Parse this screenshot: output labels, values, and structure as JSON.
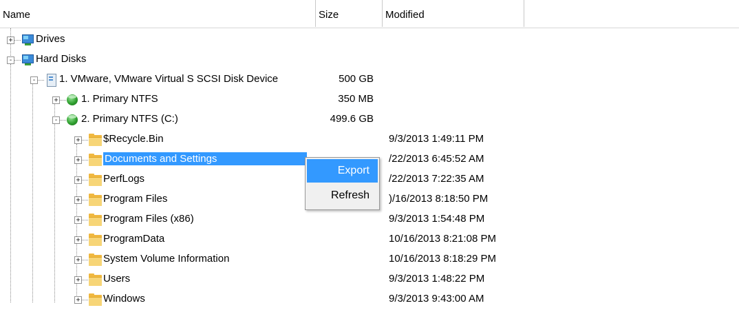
{
  "columns": {
    "name": "Name",
    "size": "Size",
    "modified": "Modified"
  },
  "tree": [
    {
      "label": "Drives",
      "icon": "monitor-icon",
      "expander": "+",
      "size": "",
      "modified": ""
    },
    {
      "label": "Hard Disks",
      "icon": "monitor-icon",
      "expander": "-",
      "size": "",
      "modified": ""
    },
    {
      "label": "1. VMware, VMware Virtual S SCSI Disk Device",
      "icon": "disk-icon",
      "expander": "-",
      "size": "500 GB",
      "modified": ""
    },
    {
      "label": "1. Primary NTFS",
      "icon": "partition-icon",
      "expander": "+",
      "size": "350 MB",
      "modified": ""
    },
    {
      "label": "2. Primary NTFS (C:)",
      "icon": "partition-icon",
      "expander": "-",
      "size": "499.6 GB",
      "modified": ""
    },
    {
      "label": "$Recycle.Bin",
      "icon": "folder-icon",
      "expander": "+",
      "size": "",
      "modified": "9/3/2013 1:49:11 PM"
    },
    {
      "label": "Documents and Settings",
      "icon": "folder-icon",
      "expander": "+",
      "size": "",
      "modified": "/22/2013 6:45:52 AM",
      "selected": true
    },
    {
      "label": "PerfLogs",
      "icon": "folder-icon",
      "expander": "+",
      "size": "",
      "modified": "/22/2013 7:22:35 AM"
    },
    {
      "label": "Program Files",
      "icon": "folder-icon",
      "expander": "+",
      "size": "",
      "modified": ")/16/2013 8:18:50 PM"
    },
    {
      "label": "Program Files (x86)",
      "icon": "folder-icon",
      "expander": "+",
      "size": "",
      "modified": "9/3/2013 1:54:48 PM"
    },
    {
      "label": "ProgramData",
      "icon": "folder-icon",
      "expander": "+",
      "size": "",
      "modified": "10/16/2013 8:21:08 PM"
    },
    {
      "label": "System Volume Information",
      "icon": "folder-icon",
      "expander": "+",
      "size": "",
      "modified": "10/16/2013 8:18:29 PM"
    },
    {
      "label": "Users",
      "icon": "folder-icon",
      "expander": "+",
      "size": "",
      "modified": "9/3/2013 1:48:22 PM"
    },
    {
      "label": "Windows",
      "icon": "folder-icon",
      "expander": "+",
      "size": "",
      "modified": "9/3/2013 9:43:00 AM"
    }
  ],
  "context_menu": {
    "items": [
      {
        "label": "Export",
        "highlighted": true
      },
      {
        "label": "Refresh",
        "highlighted": false
      }
    ]
  },
  "colors": {
    "selection": "#3399ff",
    "folder": "#f0b840",
    "partition": "#2f9f2f",
    "drive": "#3a8ad8"
  }
}
